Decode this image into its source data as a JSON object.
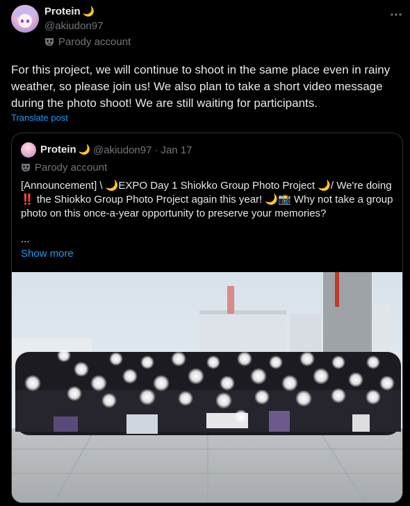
{
  "post": {
    "display_name": "Protein",
    "name_emoji": "🌙",
    "handle": "@akiudon97",
    "parody_label": "Parody account",
    "text": "For this project, we will continue to shoot in the same place even in rainy weather, so please join us! We also plan to take a short video message during the photo shoot! We are still waiting for participants.",
    "translate_label": "Translate post"
  },
  "quote": {
    "display_name": "Protein",
    "name_emoji": "🌙",
    "handle": "@akiudon97",
    "separator": "·",
    "date": "Jan 17",
    "parody_label": "Parody account",
    "text": "[Announcement] \\ 🌙EXPO Day 1 Shiokko Group Photo Project 🌙/ We're doing ‼️ the Shiokko Group Photo Project again this year! 🌙📸 Why not take a group photo on this once-a-year opportunity to preserve your memories?",
    "ellipsis": "...",
    "show_more_label": "Show more"
  },
  "icons": {
    "more": "more-icon",
    "parody": "mask-icon",
    "avatar": "avatar"
  },
  "colors": {
    "background": "#000000",
    "text": "#e7e9ea",
    "secondary": "#71767b",
    "link": "#1d9bf0",
    "border": "#2f3336",
    "moon": "#f5c542"
  }
}
